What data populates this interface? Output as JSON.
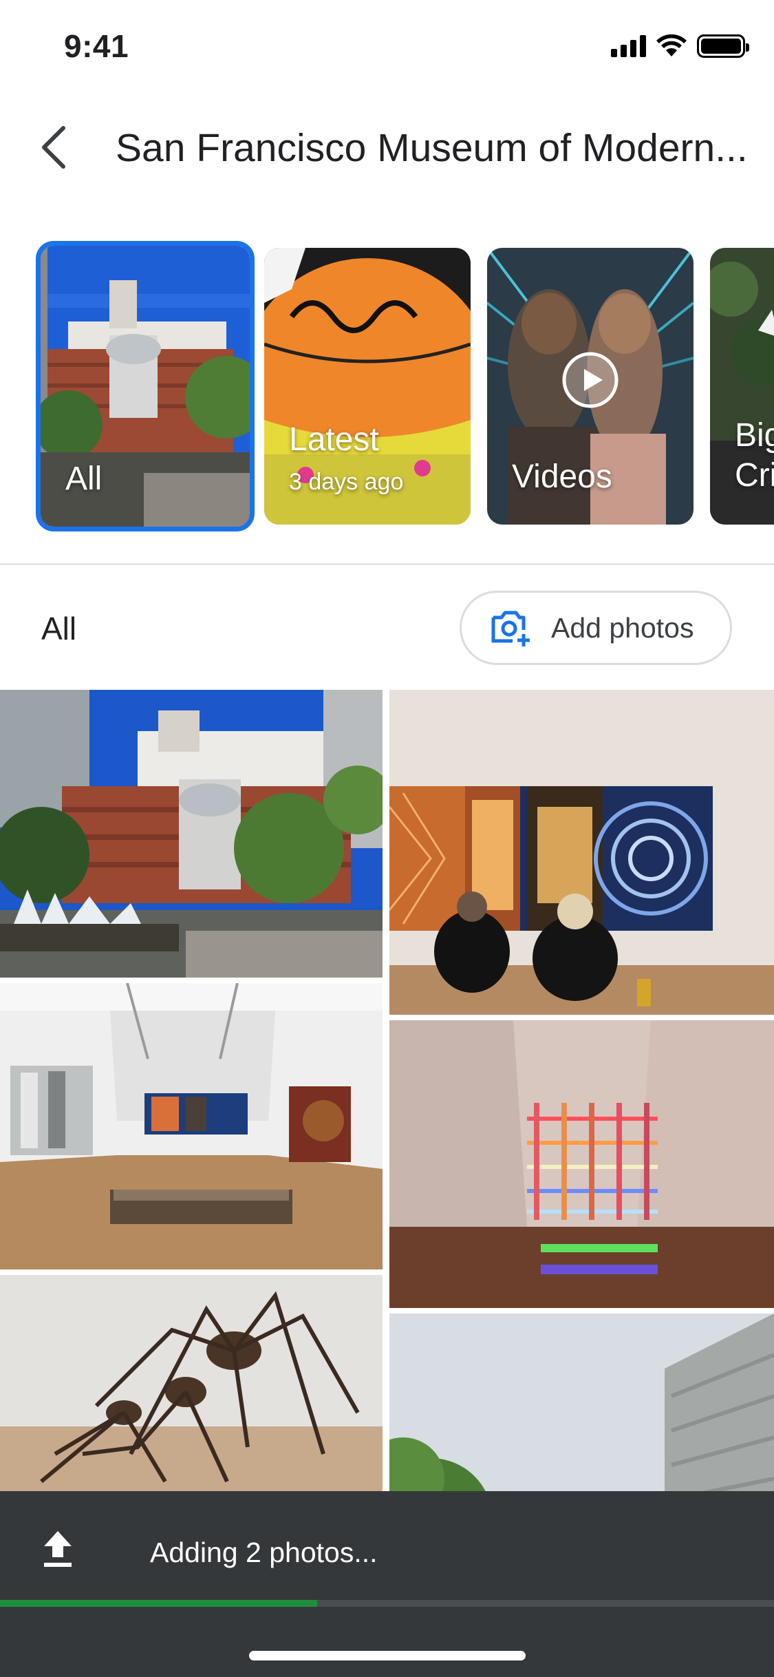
{
  "status_bar": {
    "time": "9:41"
  },
  "header": {
    "title": "San Francisco Museum of Modern..."
  },
  "carousel": {
    "cards": [
      {
        "label": "All",
        "sublabel": ""
      },
      {
        "label": "Latest",
        "sublabel": "3 days ago"
      },
      {
        "label": "Videos",
        "sublabel": ""
      },
      {
        "label": "Big Cri",
        "sublabel": ""
      }
    ]
  },
  "section": {
    "title": "All",
    "add_photos_label": "Add photos"
  },
  "upload": {
    "text": "Adding 2 photos...",
    "progress": 0.41
  },
  "colors": {
    "accent": "#1a73e8",
    "progress": "#1e8e3e",
    "banner": "#35383b"
  }
}
